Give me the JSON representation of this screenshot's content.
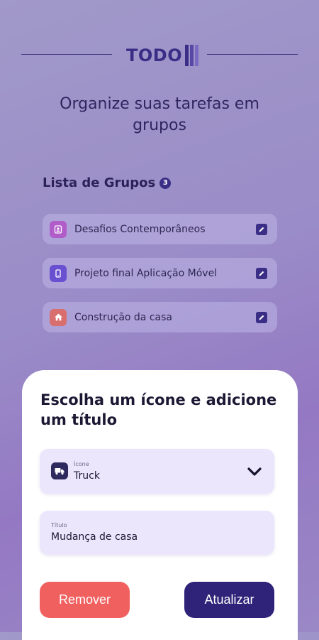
{
  "logo": {
    "text": "TODO"
  },
  "subtitle": "Organize suas tarefas em grupos",
  "groups": {
    "title": "Lista de Grupos",
    "count": "3",
    "items": [
      {
        "label": "Desafios Contemporâneos",
        "icon": "contact-card-icon",
        "color": "#b05cc9"
      },
      {
        "label": "Projeto final Aplicação Móvel",
        "icon": "phone-icon",
        "color": "#6a4fd0"
      },
      {
        "label": "Construção da casa",
        "icon": "home-icon",
        "color": "#d96e6e"
      }
    ]
  },
  "sheet": {
    "title": "Escolha um ícone e adicione um título",
    "icon_field": {
      "label": "Ícone",
      "value": "Truck"
    },
    "title_field": {
      "label": "Título",
      "value": "Mudança de casa"
    },
    "remove_label": "Remover",
    "update_label": "Atualizar"
  },
  "colors": {
    "primary": "#2e2378",
    "danger": "#f0605f",
    "field_bg": "#ece6fd"
  }
}
